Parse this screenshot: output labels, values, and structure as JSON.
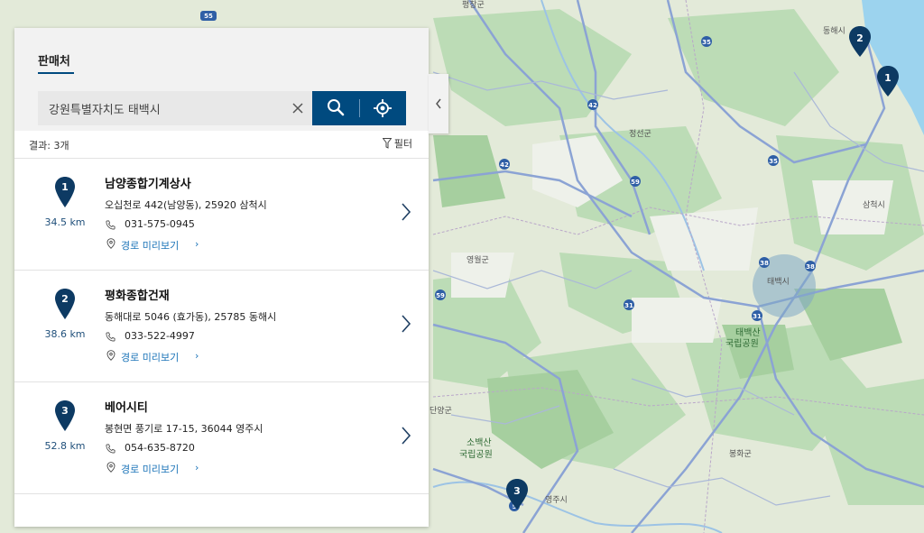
{
  "tab": {
    "label": "판매처"
  },
  "search": {
    "value": "강원특별자치도 태백시"
  },
  "results": {
    "count_label": "결과: 3개",
    "filter_label": "필터"
  },
  "dealers": [
    {
      "number": "1",
      "name": "남양종합기계상사",
      "address": "오십천로 442(남양동), 25920 삼척시",
      "phone": "031-575-0945",
      "distance": "34.5 km",
      "route_label": "경로 미리보기"
    },
    {
      "number": "2",
      "name": "평화종합건재",
      "address": "동해대로 5046 (효가동), 25785 동해시",
      "phone": "033-522-4997",
      "distance": "38.6 km",
      "route_label": "경로 미리보기"
    },
    {
      "number": "3",
      "name": "베어시티",
      "address": "봉현면 풍기로 17-15, 36044 영주시",
      "phone": "054-635-8720",
      "distance": "52.8 km",
      "route_label": "경로 미리보기"
    }
  ],
  "map": {
    "labels": {
      "pyeongchang": "평창군",
      "donghae": "동해시",
      "jeongseon": "정선군",
      "samcheok": "삼척시",
      "yeongwol": "영월군",
      "taebaek": "태백시",
      "taebaeksan_1": "태백산",
      "taebaeksan_2": "국립공원",
      "sobaeksan_1": "소백산",
      "sobaeksan_2": "국립공원",
      "yeongju": "영주시",
      "bonghwa": "봉화군",
      "danyang": "단양군"
    },
    "shields": [
      "55",
      "35",
      "42",
      "35",
      "42",
      "59",
      "38",
      "38",
      "31",
      "59",
      "31",
      "5"
    ],
    "pins": [
      "1",
      "2",
      "3"
    ]
  },
  "colors": {
    "accent": "#004a7f",
    "link": "#1a73b8",
    "pin": "#0d3a63"
  }
}
